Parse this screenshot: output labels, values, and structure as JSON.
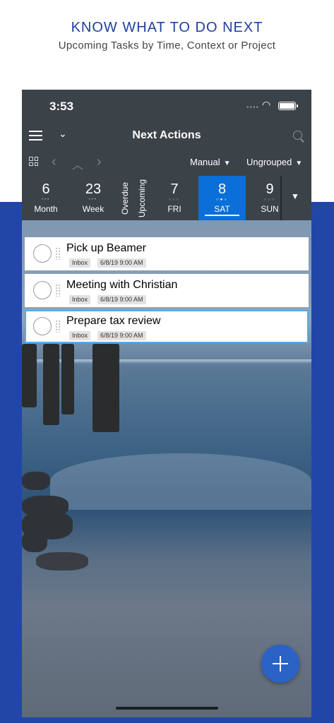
{
  "promo": {
    "headline": "KNOW WHAT TO DO NEXT",
    "subline": "Upcoming Tasks by Time, Context or Project"
  },
  "status_bar": {
    "time": "3:53",
    "signal_icon": "signal-dots-icon",
    "wifi_icon": "wifi-icon",
    "battery_icon": "battery-icon"
  },
  "nav": {
    "menu_icon": "hamburger-menu-icon",
    "dropdown_icon": "chevron-down-icon",
    "title": "Next Actions",
    "search_icon": "search-icon"
  },
  "toolbar": {
    "grid_icon": "grid-icon",
    "prev_icon": "chevron-left-icon",
    "up_icon": "chevron-up-icon",
    "next_icon": "chevron-right-icon",
    "sort": "Manual",
    "group": "Ungrouped"
  },
  "date_strip": {
    "month": {
      "num": "6",
      "label": "Month",
      "dots": "•••"
    },
    "week": {
      "num": "23",
      "label": "Week",
      "dots": "•••"
    },
    "overdue": "Overdue",
    "upcoming": "Upcoming",
    "fri": {
      "num": "7",
      "label": "FRI",
      "dots": "○○○"
    },
    "sat": {
      "num": "8",
      "label": "SAT",
      "dots": "○●○"
    },
    "sun": {
      "num": "9",
      "label": "SUN",
      "dots": "○○○"
    },
    "more_icon": "chevron-down-icon"
  },
  "tasks": [
    {
      "title": "Pick up Beamer",
      "context": "Inbox",
      "due": "6/8/19 9:00 AM"
    },
    {
      "title": "Meeting with Christian",
      "context": "Inbox",
      "due": "6/8/19 9:00 AM"
    },
    {
      "title": "Prepare tax review",
      "context": "Inbox",
      "due": "6/8/19 9:00 AM"
    }
  ],
  "fab_icon": "plus-icon",
  "colors": {
    "brand_blue": "#2246a8",
    "header_bg": "#3b4248",
    "selected_day": "#0a6fd8",
    "fab": "#2a62c6"
  }
}
